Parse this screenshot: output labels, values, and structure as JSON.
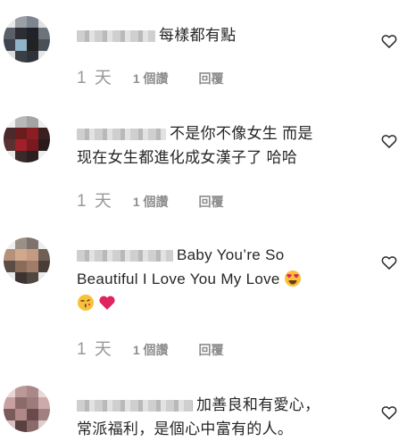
{
  "comments": [
    {
      "text": "每樣都有點",
      "time": "1 天",
      "likes": "1 個讚",
      "reply": "回覆"
    },
    {
      "text_line1": "不是你不像女生 而是",
      "text_line2": "现在女生都進化成女漢子了 哈哈",
      "time": "1 天",
      "likes": "1 個讚",
      "reply": "回覆"
    },
    {
      "text_line1": "Baby You’re So",
      "text_line2": "Beautiful I Love You My Love",
      "time": "1 天",
      "likes": "1 個讚",
      "reply": "回覆"
    },
    {
      "text_line1": "加善良和有愛心，",
      "text_line2": "常派福利，是個心中富有的人。"
    }
  ],
  "colors": {
    "heart_outline": "#262626",
    "meta_gray": "#8e8e8e",
    "red_heart": "#e0245e"
  },
  "icons": {
    "like": "heart-outline-icon",
    "emoji_heart_eyes": "heart-eyes-emoji",
    "emoji_kiss": "kissing-face-emoji",
    "emoji_red_heart": "red-heart-emoji"
  }
}
